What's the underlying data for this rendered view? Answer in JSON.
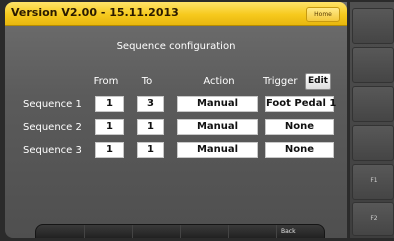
{
  "header": {
    "version": "Version V2.00 - 15.11.2013",
    "home_label": "Home"
  },
  "panel": {
    "title": "Sequence configuration",
    "columns": {
      "from": "From",
      "to": "To",
      "action": "Action",
      "trigger": "Trigger"
    },
    "edit_label": "Edit",
    "rows": [
      {
        "label": "Sequence 1",
        "from": "1",
        "to": "3",
        "action": "Manual",
        "trigger": "Foot Pedal 1"
      },
      {
        "label": "Sequence 2",
        "from": "1",
        "to": "1",
        "action": "Manual",
        "trigger": "None"
      },
      {
        "label": "Sequence 3",
        "from": "1",
        "to": "1",
        "action": "Manual",
        "trigger": "None"
      }
    ]
  },
  "bottom_bar": {
    "back_label": "Back"
  },
  "side_panel": {
    "f1_label": "F1",
    "f2_label": "F2"
  },
  "colors": {
    "title_bar": "#f6c91d",
    "panel_bg": "#5b5b5b",
    "field_bg": "#ffffff"
  }
}
